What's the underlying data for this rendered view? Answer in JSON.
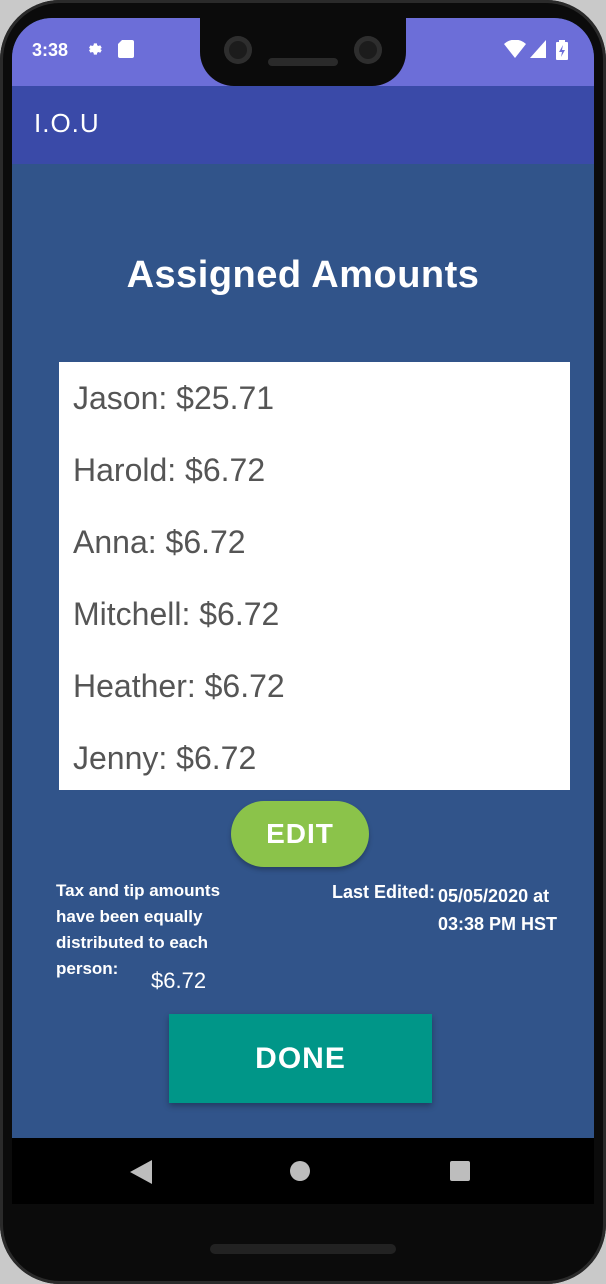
{
  "status_bar": {
    "time": "3:38"
  },
  "app_bar": {
    "title": "I.O.U"
  },
  "screen": {
    "heading": "Assigned Amounts",
    "amounts": [
      "Jason: $25.71",
      "Harold: $6.72",
      "Anna: $6.72",
      "Mitchell: $6.72",
      "Heather: $6.72",
      "Jenny: $6.72"
    ],
    "edit_label": "EDIT",
    "tax_note": "Tax and tip amounts have been equally distributed to each person:",
    "tax_amount": "$6.72",
    "last_edited_label": "Last Edited:",
    "last_edited_value": "05/05/2020 at 03:38 PM HST",
    "done_label": "DONE"
  },
  "colors": {
    "status_bar": "#6c6ed8",
    "app_bar": "#3a4aa8",
    "background": "#31548a",
    "edit_button": "#8bc34a",
    "done_button": "#009688"
  },
  "icons": [
    "settings-icon",
    "sd-card-icon",
    "wifi-icon",
    "signal-icon",
    "battery-icon",
    "back-icon",
    "home-icon",
    "recents-icon"
  ]
}
